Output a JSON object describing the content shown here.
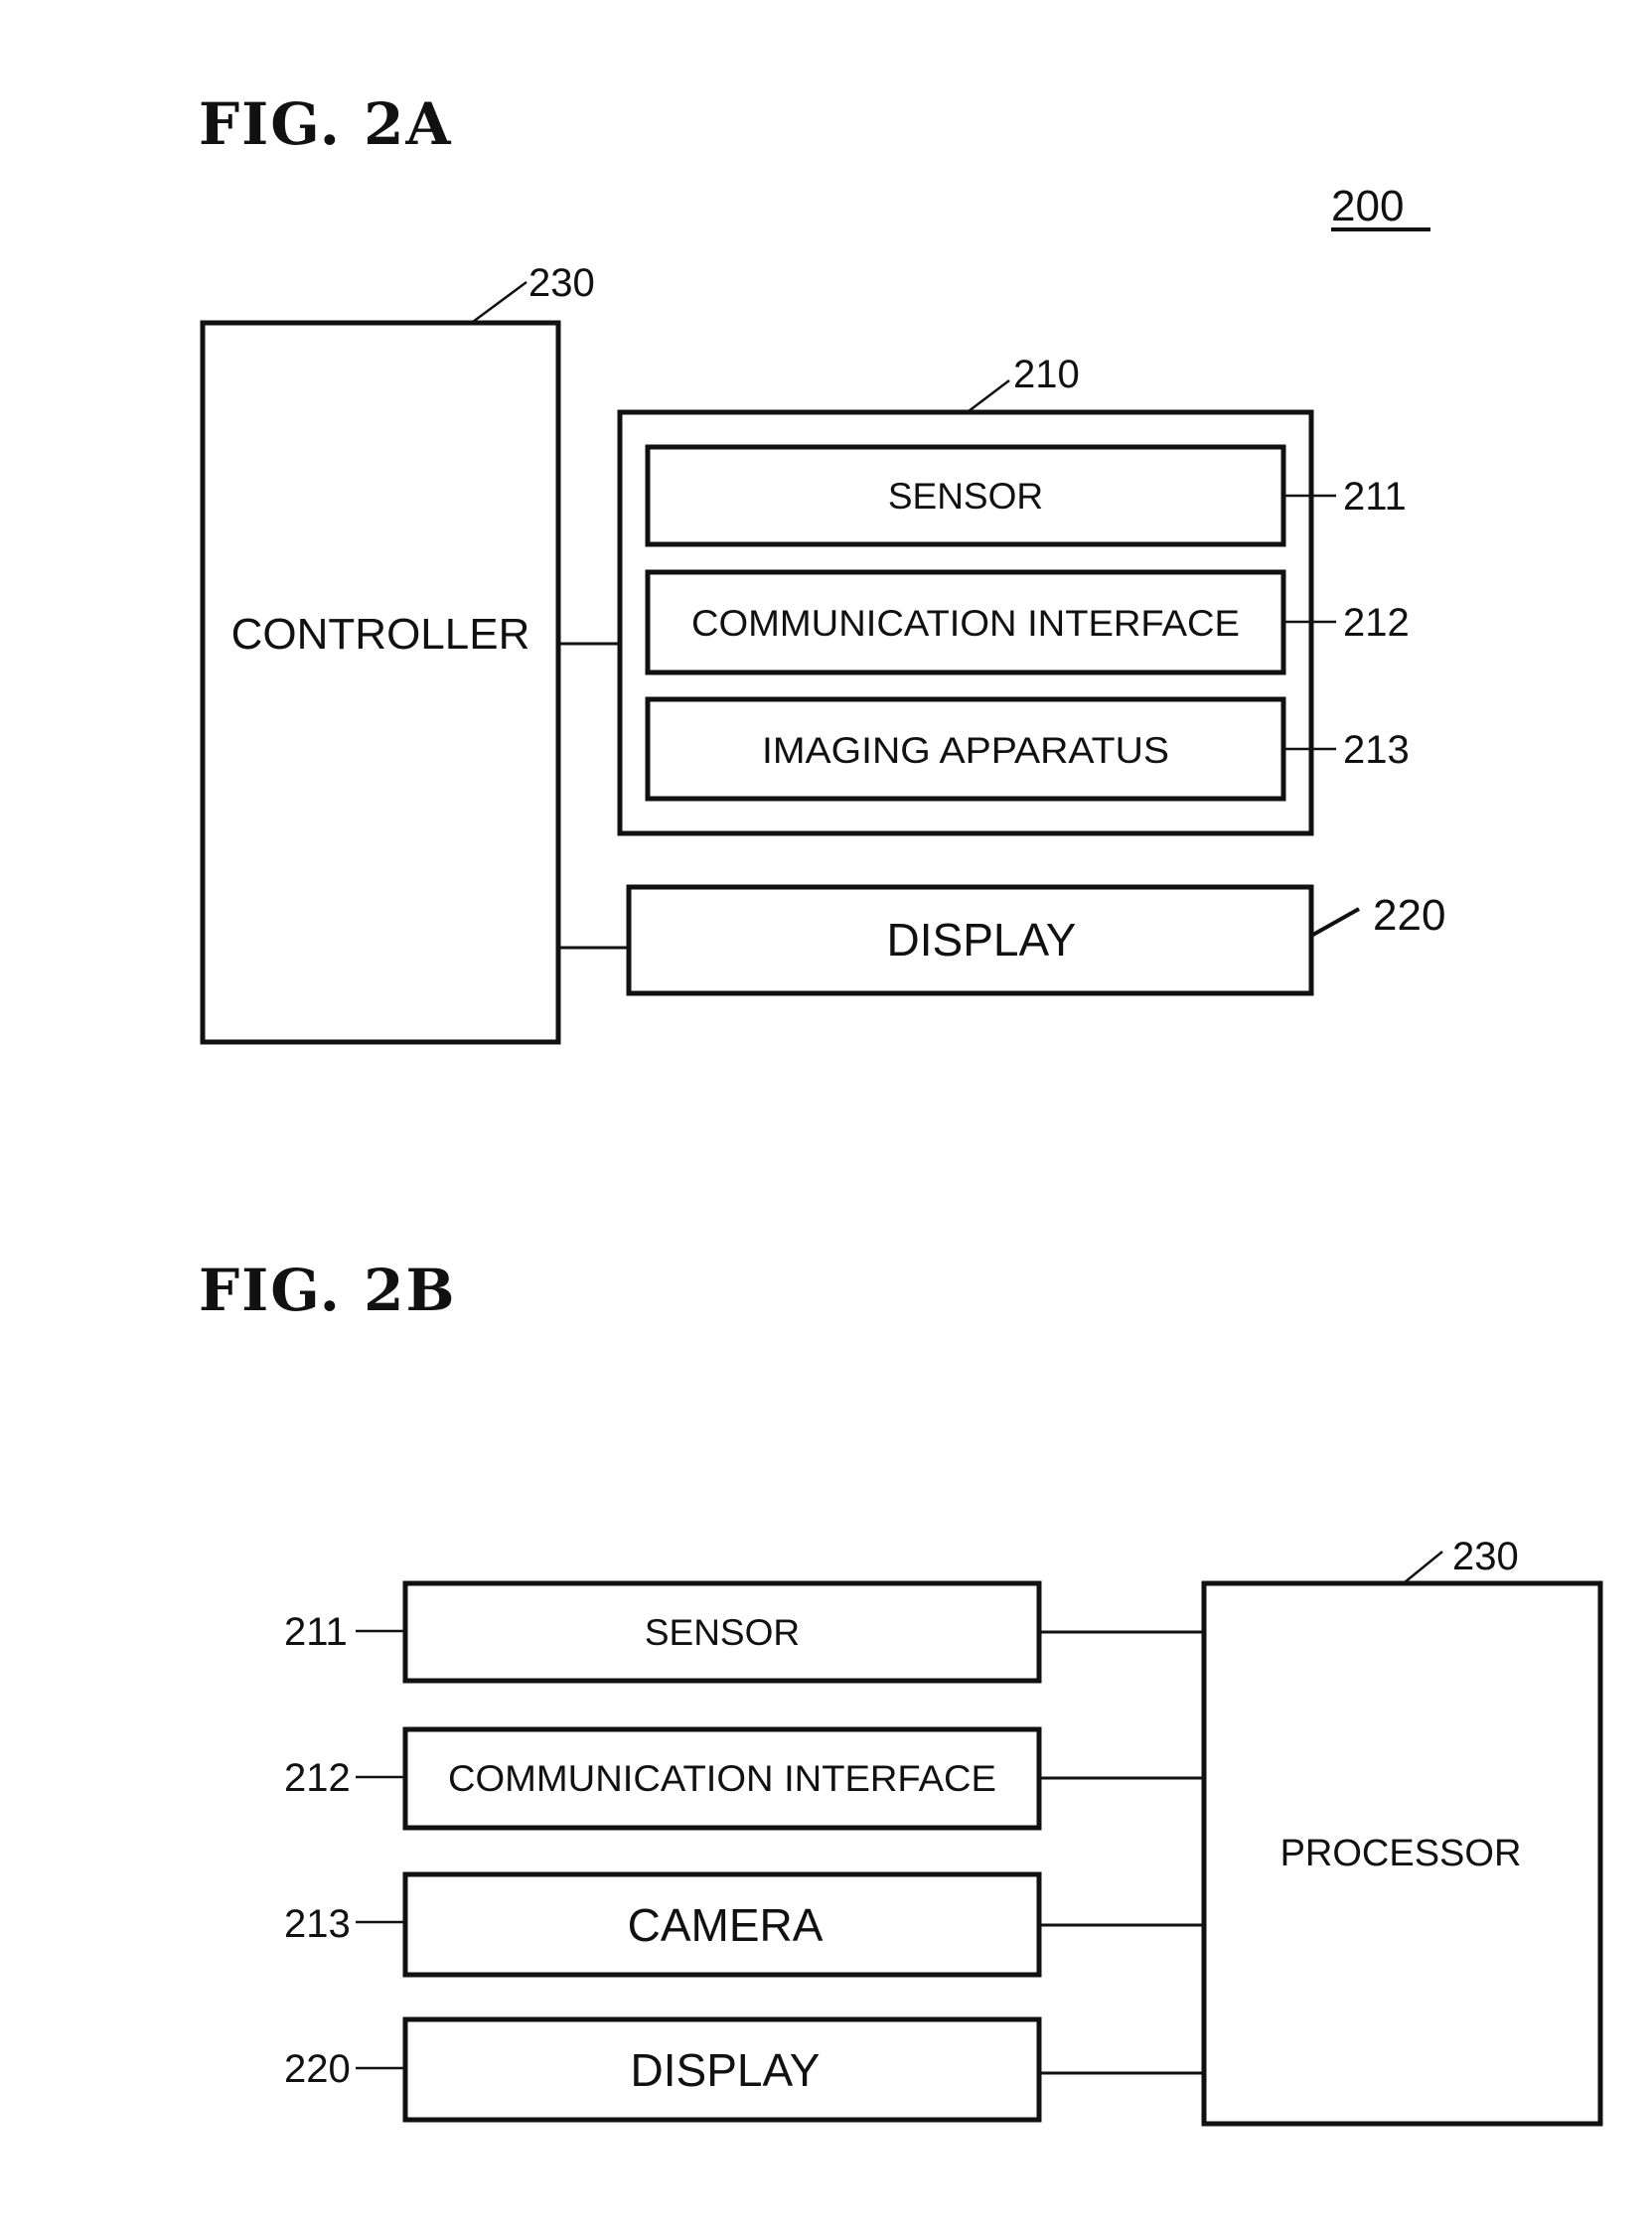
{
  "fig2a": {
    "title": "FIG. 2A",
    "device_ref": "200",
    "controller": {
      "label": "CONTROLLER",
      "ref": "230"
    },
    "module": {
      "ref": "210",
      "items": [
        {
          "label": "SENSOR",
          "ref": "211"
        },
        {
          "label": "COMMUNICATION INTERFACE",
          "ref": "212"
        },
        {
          "label": "IMAGING APPARATUS",
          "ref": "213"
        }
      ]
    },
    "display": {
      "label": "DISPLAY",
      "ref": "220"
    }
  },
  "fig2b": {
    "title": "FIG. 2B",
    "processor": {
      "label": "PROCESSOR",
      "ref": "230"
    },
    "items": [
      {
        "label": "SENSOR",
        "ref": "211"
      },
      {
        "label": "COMMUNICATION INTERFACE",
        "ref": "212"
      },
      {
        "label": "CAMERA",
        "ref": "213"
      },
      {
        "label": "DISPLAY",
        "ref": "220"
      }
    ]
  }
}
